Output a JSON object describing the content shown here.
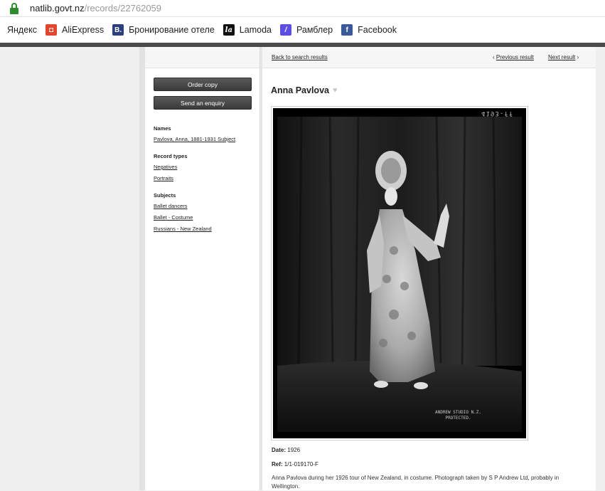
{
  "browser": {
    "url_host": "natlib.govt.nz",
    "url_path": "/records/22762059",
    "bookmarks": [
      {
        "label": "Яндекс",
        "icon": "yandex-icon"
      },
      {
        "label": "AliExpress",
        "icon": "aliexpress-icon"
      },
      {
        "label": "Бронирование отеле",
        "icon": "booking-icon"
      },
      {
        "label": "Lamoda",
        "icon": "lamoda-icon"
      },
      {
        "label": "Рамблер",
        "icon": "rambler-icon"
      },
      {
        "label": "Facebook",
        "icon": "facebook-icon"
      }
    ]
  },
  "sidebar": {
    "order_copy": "Order copy",
    "send_enquiry": "Send an enquiry",
    "sections": [
      {
        "heading": "Names",
        "links": [
          "Pavlova, Anna, 1881-1931 Subject"
        ]
      },
      {
        "heading": "Record types",
        "links": [
          "Negatives",
          "Portraits"
        ]
      },
      {
        "heading": "Subjects",
        "links": [
          "Ballet dancers",
          "Ballet - Costume",
          "Russians - New Zealand"
        ]
      }
    ]
  },
  "main": {
    "back_link": "Back to search results",
    "previous": "Previous result",
    "next": "Next result",
    "title": "Anna Pavlova",
    "photo_caption_top": "4193-ff",
    "photo_stamp_line1": "ANDREW STUDIO N.Z.",
    "photo_stamp_line2": "PROTECTED.",
    "date_label": "Date:",
    "date_value": "1926",
    "ref_label": "Ref:",
    "ref_value": "1/1-019170-F",
    "description": "Anna Pavlova during her 1926 tour of New Zealand, in costume. Photograph taken by S P Andrew Ltd, probably in Wellington."
  },
  "colors": {
    "lock_green": "#2e8b2e",
    "button_dark": "#3a3a3a",
    "page_bg": "#efefef"
  }
}
